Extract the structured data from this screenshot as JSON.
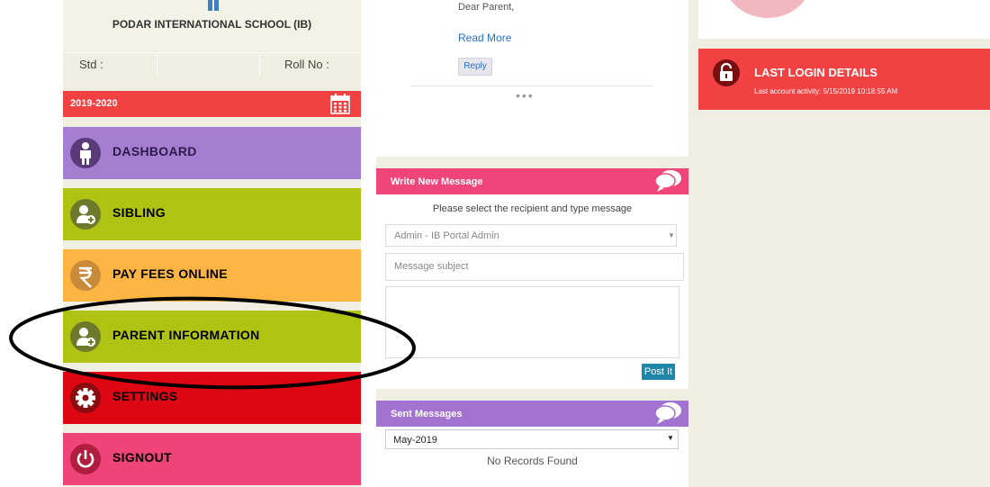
{
  "school": {
    "name": "PODAR INTERNATIONAL SCHOOL (IB)",
    "std_label": "Std :",
    "roll_label": "Roll No :"
  },
  "year": {
    "label": "2019-2020",
    "icon": "calendar-icon"
  },
  "nav": {
    "items": [
      {
        "label": "DASHBOARD",
        "icon": "person-icon",
        "bg": "#a57ed2",
        "text_color": "#2b1a4a"
      },
      {
        "label": "SIBLING",
        "icon": "add-user-icon",
        "bg": "#b0c312",
        "text_color": "#1a1a1a"
      },
      {
        "label": "PAY FEES ONLINE",
        "icon": "rupee-icon",
        "bg": "#fcb543",
        "text_color": "#1a1a1a"
      },
      {
        "label": "PARENT INFORMATION",
        "icon": "add-user-icon",
        "bg": "#b0c312",
        "text_color": "#1a1a1a"
      },
      {
        "label": "SETTINGS",
        "icon": "gear-icon",
        "bg": "#de0612",
        "text_color": "#1a1a1a"
      },
      {
        "label": "SIGNOUT",
        "icon": "power-icon",
        "bg": "#ee4479",
        "text_color": "#1a1a1a"
      }
    ]
  },
  "message_card": {
    "dear": "Dear Parent,",
    "read_more": "Read More",
    "reply": "Reply",
    "more": "•••"
  },
  "write_message": {
    "title": "Write New Message",
    "icon": "chat-bubble-icon",
    "instruction": "Please select the recipient and type message",
    "recipient": "Admin - IB Portal Admin",
    "subject_placeholder": "Message subject",
    "post_label": "Post It"
  },
  "sent_messages": {
    "title": "Sent Messages",
    "icon": "chat-bubble-icon",
    "month": "May-2019",
    "empty_text": "No Records Found"
  },
  "last_login": {
    "title": "LAST LOGIN DETAILS",
    "activity": "Last account activity: 5/15/2019 10:18:55 AM",
    "icon": "lock-icon"
  },
  "colors": {
    "page_bg": "#f0ede1",
    "red_accent": "#f24142",
    "pink_header": "#ef4579",
    "purple_header": "#a172d0",
    "post_button": "#1e86a8"
  }
}
